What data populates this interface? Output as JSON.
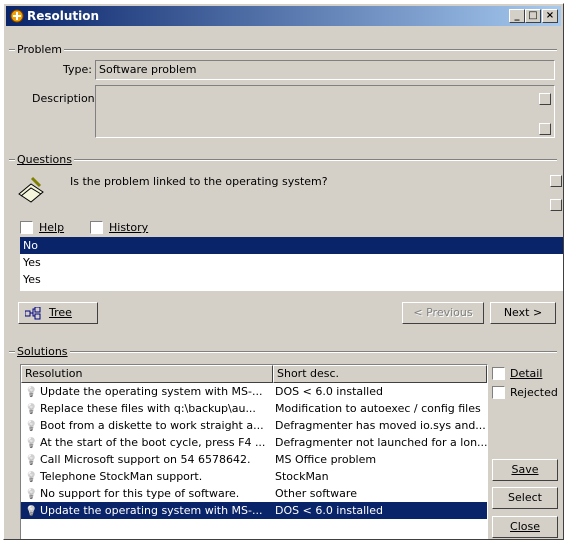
{
  "window": {
    "title": "Resolution"
  },
  "problem": {
    "group_label": "Problem",
    "type_label": "Type:",
    "type_value": "Software problem",
    "description_label": "Description:",
    "description_value": ""
  },
  "questions": {
    "group_label": "Questions",
    "question_text": "Is the problem linked to the operating system?",
    "help_label": "Help",
    "history_label": "History",
    "answers": [
      "No",
      "Yes",
      "Yes"
    ],
    "tree_label": "Tree",
    "previous_label": "< Previous",
    "next_label": "Next >"
  },
  "solutions": {
    "group_label": "Solutions",
    "columns": [
      "Resolution",
      "Short desc."
    ],
    "rows": [
      {
        "resolution": "Update the operating system with MS-...",
        "short": "DOS < 6.0 installed"
      },
      {
        "resolution": "Replace these files with q:\\backup\\au...",
        "short": "Modification to autoexec / config files"
      },
      {
        "resolution": "Boot from a diskette to work straight a...",
        "short": "Defragmenter has moved io.sys and..."
      },
      {
        "resolution": "At the start of the boot cycle, press F4 ...",
        "short": "Defragmenter not launched for a lon..."
      },
      {
        "resolution": "Call Microsoft support on 54 6578642.",
        "short": "MS Office problem"
      },
      {
        "resolution": "Telephone StockMan support.",
        "short": "StockMan"
      },
      {
        "resolution": "No support for this type of software.",
        "short": "Other software"
      },
      {
        "resolution": "Update the operating system with MS-...",
        "short": "DOS < 6.0 installed"
      }
    ],
    "detail_label": "Detail",
    "rejected_label": "Rejected",
    "save_label": "Save",
    "select_label": "Select",
    "close_label": "Close"
  }
}
